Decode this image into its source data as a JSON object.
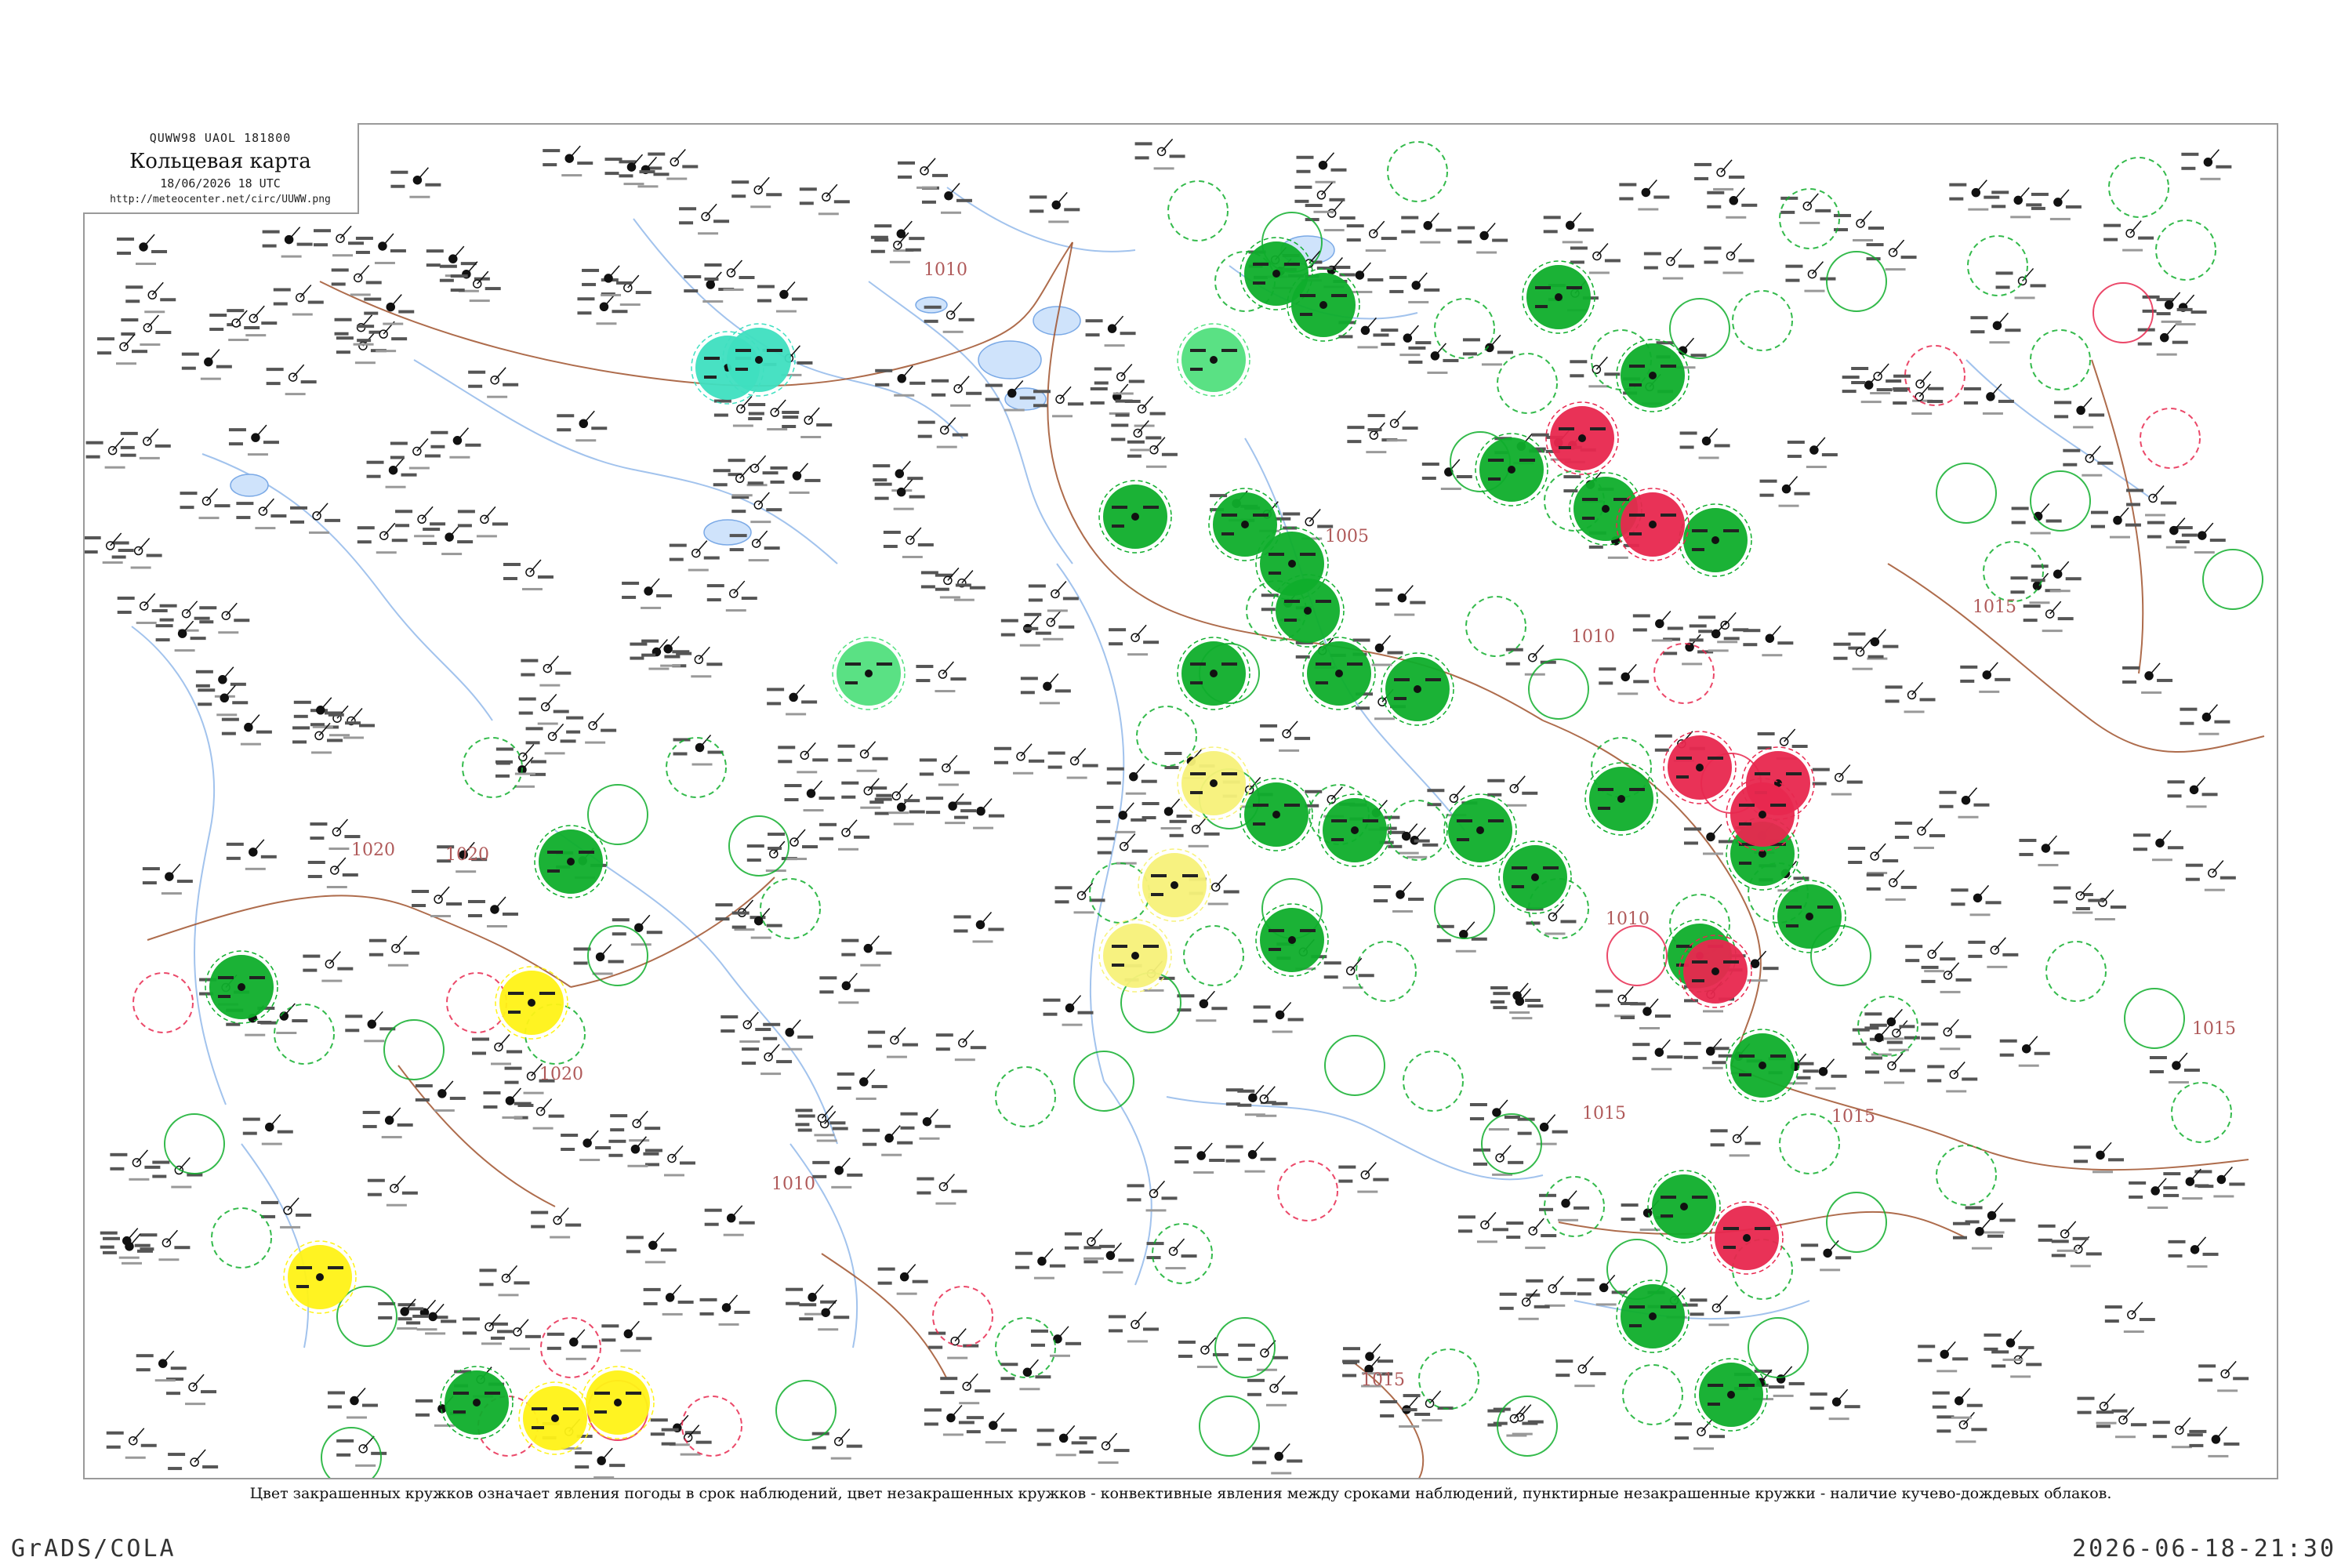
{
  "header": {
    "code": "QUWW98  UAOL  181800",
    "title": "Кольцевая карта",
    "datetime": "18/06/2026 18 UTC",
    "url": "http://meteocenter.net/circ/UUWW.png"
  },
  "caption": "Цвет закрашенных кружков означает явления погоды в срок наблюдений, цвет незакрашенных кружков - конвективные явления между сроками наблюдений, пунктирные незакрашенные кружки - наличие кучево-дождевых облаков.",
  "footer": {
    "left": "GrADS/COLA",
    "right": "2026-06-18-21:30"
  },
  "isobar_labels": [
    "1010",
    "1005",
    "1020",
    "1020",
    "1020",
    "1015",
    "1015",
    "1015",
    "1010",
    "1010",
    "1010",
    "1015",
    "1015"
  ],
  "colors": {
    "green": "#0fae2c",
    "red": "#e8284f",
    "yellow": "#fff317",
    "pale_yellow": "#f7f27a",
    "teal": "#3fe0c0",
    "light_green": "#52e07e",
    "isobar": "#a0522d",
    "river": "#7aa9e6"
  },
  "filled_circles": {
    "green": 30,
    "red": 7,
    "yellow": 4,
    "pale_yellow": 3,
    "teal": 2,
    "light_green": 2
  }
}
